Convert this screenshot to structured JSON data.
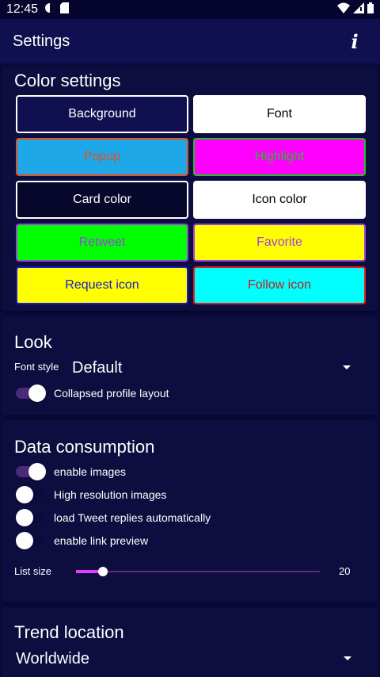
{
  "status_bar": {
    "time": "12:45",
    "left_icons": [
      "circle-half-icon",
      "sd-card-icon"
    ],
    "right_icons": [
      "wifi-icon",
      "signal-icon",
      "battery-icon"
    ]
  },
  "app_bar": {
    "title": "Settings",
    "info_label": "i"
  },
  "color_settings": {
    "title": "Color settings",
    "buttons": [
      {
        "label": "Background",
        "bg": "#101050",
        "text": "#ffffff",
        "border": "#ffffff"
      },
      {
        "label": "Font",
        "bg": "#ffffff",
        "text": "#000000",
        "border": "#ffffff"
      },
      {
        "label": "Popup",
        "bg": "#1ea8e8",
        "text": "#e05020",
        "border": "#e05020"
      },
      {
        "label": "Highlight",
        "bg": "#ff00ff",
        "text": "#20c020",
        "border": "#20c020"
      },
      {
        "label": "Card color",
        "bg": "#07072c",
        "text": "#ffffff",
        "border": "#ffffff"
      },
      {
        "label": "Icon color",
        "bg": "#ffffff",
        "text": "#000000",
        "border": "#ffffff"
      },
      {
        "label": "Retweet",
        "bg": "#00ff00",
        "text": "#a040e0",
        "border": "#a040e0"
      },
      {
        "label": "Favorite",
        "bg": "#ffff00",
        "text": "#a040e0",
        "border": "#a040e0"
      },
      {
        "label": "Request icon",
        "bg": "#ffff00",
        "text": "#1a1ad0",
        "border": "#1a1ad0"
      },
      {
        "label": "Follow icon",
        "bg": "#00ffff",
        "text": "#c02020",
        "border": "#e02020"
      }
    ]
  },
  "look": {
    "title": "Look",
    "font_style_label": "Font style",
    "font_style_value": "Default",
    "collapsed_profile_label": "Collapsed profile layout",
    "collapsed_profile_on": true
  },
  "data_consumption": {
    "title": "Data consumption",
    "toggles": [
      {
        "label": "enable images",
        "on": true
      },
      {
        "label": "High resolution images",
        "on": false
      },
      {
        "label": "load Tweet replies automatically",
        "on": false
      },
      {
        "label": "enable link preview",
        "on": false
      }
    ],
    "list_size_label": "List size",
    "list_size_value": "20",
    "list_size_fraction": 0.11
  },
  "trend_location": {
    "title": "Trend location",
    "value": "Worldwide"
  },
  "colors": {
    "background": "#0a0a3c",
    "app_bar": "#101050",
    "card": "#0d0d40",
    "accent": "#e040fb"
  }
}
